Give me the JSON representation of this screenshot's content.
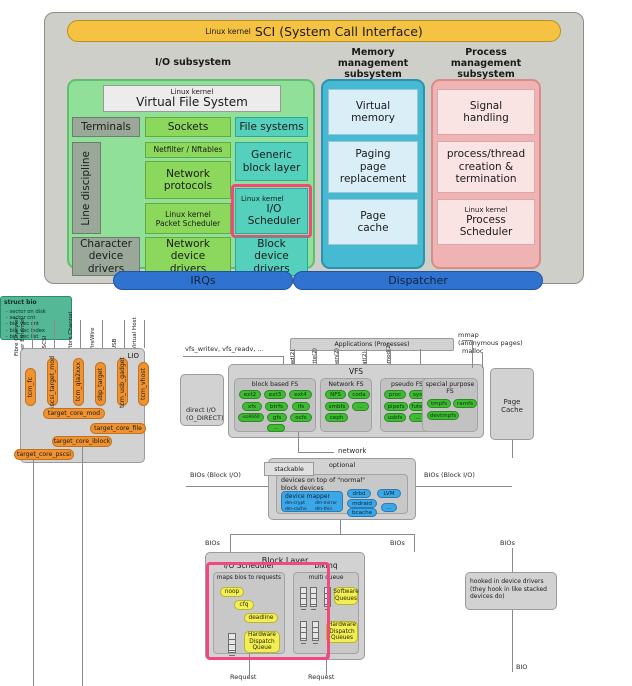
{
  "top_diagram": {
    "sci": {
      "kernel_tag": "Linux kernel",
      "title": "SCI (System Call Interface)"
    },
    "columns": {
      "io": "I/O subsystem",
      "mm": "Memory\nmanagement\nsubsystem",
      "pm": "Process\nmanagement\nsubsystem"
    },
    "vfs": {
      "kernel_tag": "Linux kernel",
      "title": "Virtual File System"
    },
    "io_boxes": {
      "terminals": "Terminals",
      "sockets": "Sockets",
      "file_systems": "File systems",
      "line_discipline": "Line discipline",
      "netfilter": "Netfilter / Nftables",
      "network_protocols": "Network protocols",
      "packet_scheduler_tag": "Linux kernel",
      "packet_scheduler": "Packet Scheduler",
      "generic_block_layer": "Generic block layer",
      "io_scheduler_tag": "Linux kernel",
      "io_scheduler": "I/O Scheduler",
      "character_device_drivers": "Character device drivers",
      "network_device_drivers": "Network device drivers",
      "block_device_drivers": "Block device drivers"
    },
    "mm_boxes": {
      "virtual_memory": "Virtual memory",
      "paging": "Paging page replacement",
      "page_cache": "Page cache"
    },
    "pm_boxes": {
      "signal_handling": "Signal handling",
      "process_thread": "process/thread creation & termination",
      "process_scheduler_tag": "Linux kernel",
      "process_scheduler": "Process Scheduler"
    },
    "bottom_bars": {
      "irqs": "IRQs",
      "dispatcher": "Dispatcher"
    },
    "colors": {
      "sci": "#f5c242",
      "io": "#90e09a",
      "mm": "#46b9d3",
      "pm": "#f0b3b3",
      "bar": "#2f72cf",
      "highlight": "#f2477f",
      "frame": "#cfcfc9"
    }
  },
  "bottom_diagram": {
    "lio": {
      "title": "LIO",
      "transports": [
        "Fibre Channel over Ethernet",
        "iSCSI",
        "Fibre Channel",
        "FireWire",
        "USB",
        "Virtual Host"
      ],
      "fabric_modules": [
        "tcm_fc",
        "iscsi_target_mod",
        "tcm_qla2xxx",
        "sbp_target",
        "tcm_usb_gadget",
        "tcm_vhost"
      ],
      "core": "target_core_mod",
      "backends": [
        "target_core_file",
        "target_core_iblock",
        "target_core_pscsi"
      ]
    },
    "applications": "Applications (Processes)",
    "syscalls": [
      "read(2)",
      "write(2)",
      "open(2)",
      "stat(2)",
      "chmod(2)",
      "..."
    ],
    "mmap_label": "mmap\n(anonymous pages)",
    "malloc_label": "malloc",
    "vfs_label": "VFS",
    "vfs_helpers": "vfs_writev, vfs_readv, ...",
    "direct_io": "direct I/O\n(O_DIRECT)",
    "fs_groups": [
      {
        "title": "block based FS",
        "items": [
          "ext2",
          "ext3",
          "ext4",
          "xfs",
          "btrfs",
          "ifs",
          "iso9660",
          "gfs",
          "ocfs",
          "..."
        ]
      },
      {
        "title": "Network FS",
        "items": [
          "NFS",
          "coda",
          "smbfs",
          "...",
          "ceph"
        ]
      },
      {
        "title": "pseudo FS",
        "items": [
          "proc",
          "sysfs",
          "pipefs",
          "futexfs",
          "usbfs",
          "..."
        ]
      },
      {
        "title": "special purpose FS",
        "items": [
          "tmpfs",
          "ramfs",
          "devtmpfs"
        ]
      }
    ],
    "network_label": "network",
    "page_cache": "Page Cache",
    "struct_bio": {
      "title": "struct bio",
      "fields": [
        "- sector on disk",
        "- sector cnt",
        "- bio_vec cnt",
        "- bio_vec index",
        "- bio_vec list"
      ]
    },
    "bios_label": "BIOs (Block I/O)",
    "bios_short": "BIOs",
    "optional": "optional",
    "stackable": "stackable",
    "devices_title": "devices on top of \"normal\" block devices",
    "device_mapper": {
      "title": "device mapper",
      "items": [
        "dm-crypt",
        "dm-mirror",
        "dm-cache",
        "dm-thin"
      ]
    },
    "stacked_chips": [
      "drbd",
      "LVM",
      "mdraid",
      "bcache",
      "..."
    ],
    "block_layer": "Block Layer",
    "io_scheduler": {
      "title": "I/O Scheduler",
      "subtitle": "maps bios to requests",
      "schedulers": [
        "noop",
        "cfq",
        "deadline"
      ],
      "dispatch_queue": "Hardware Dispatch Queue"
    },
    "blkmq": {
      "title": "blkmq",
      "subtitle": "multi queue",
      "software_queues": "Software Queues",
      "hardware_queues": "Hardware Dispatch Queues"
    },
    "request_label": "Request",
    "hooked": "hooked in device drivers (they hook in like stacked devices do)",
    "bio_label": "BIO"
  }
}
